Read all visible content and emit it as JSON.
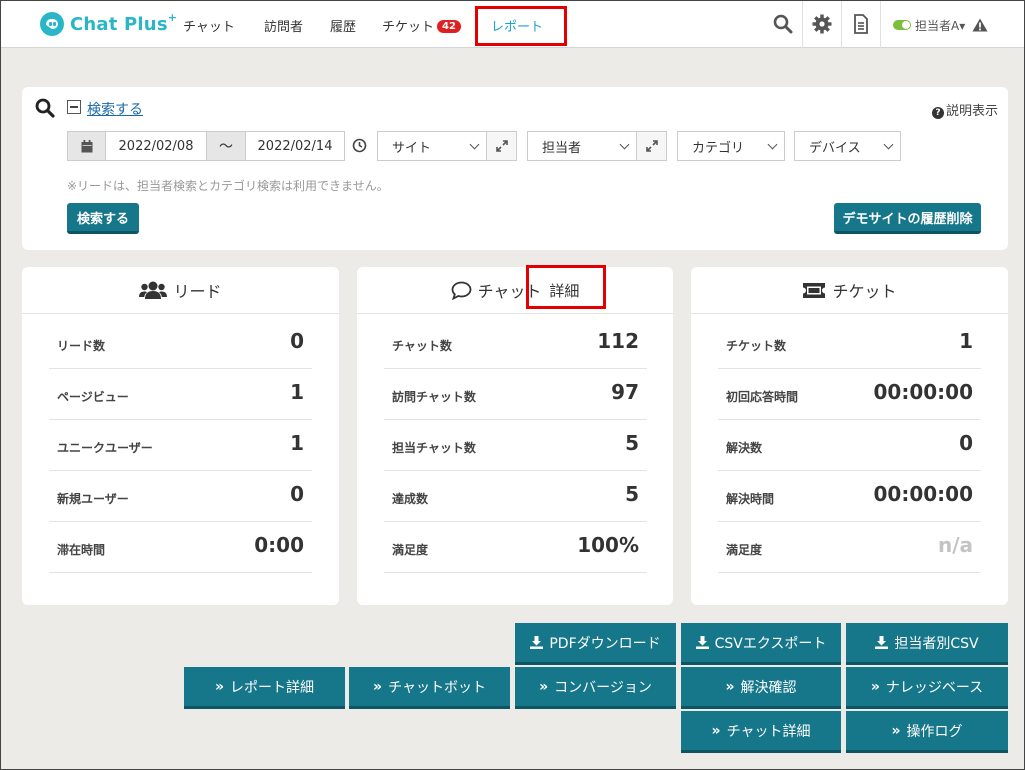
{
  "app": {
    "logo_text": "Chat Plus",
    "logo_plus": "+"
  },
  "nav": {
    "items": [
      {
        "label": "チャット"
      },
      {
        "label": "訪問者"
      },
      {
        "label": "履歴"
      },
      {
        "label": "チケット",
        "badge": "42"
      },
      {
        "label": "レポート"
      }
    ],
    "agent_label": "担当者A▾",
    "icons": [
      "search-icon",
      "gear-icon",
      "document-icon",
      "warning-icon"
    ]
  },
  "search": {
    "toggle_label": "検索する",
    "help_label": "説明表示",
    "date_from": "2022/02/08",
    "date_sep": "〜",
    "date_to": "2022/02/14",
    "site_select": "サイト",
    "agent_select": "担当者",
    "category_select": "カテゴリ",
    "device_select": "デバイス",
    "note": "※リードは、担当者検索とカテゴリ検索は利用できません。",
    "search_button": "検索する",
    "delete_button": "デモサイトの履歴削除"
  },
  "cards": {
    "lead": {
      "title": "リード",
      "rows": [
        {
          "label": "リード数",
          "value": "0"
        },
        {
          "label": "ページビュー",
          "value": "1"
        },
        {
          "label": "ユニークユーザー",
          "value": "1"
        },
        {
          "label": "新規ユーザー",
          "value": "0"
        },
        {
          "label": "滞在時間",
          "value": "0:00"
        }
      ]
    },
    "chat": {
      "title": "チャット",
      "detail_label": "詳細",
      "rows": [
        {
          "label": "チャット数",
          "value": "112"
        },
        {
          "label": "訪問チャット数",
          "value": "97"
        },
        {
          "label": "担当チャット数",
          "value": "5"
        },
        {
          "label": "達成数",
          "value": "5"
        },
        {
          "label": "満足度",
          "value": "100%"
        }
      ]
    },
    "ticket": {
      "title": "チケット",
      "rows": [
        {
          "label": "チケット数",
          "value": "1"
        },
        {
          "label": "初回応答時間",
          "value": "00:00:00"
        },
        {
          "label": "解決数",
          "value": "0"
        },
        {
          "label": "解決時間",
          "value": "00:00:00"
        },
        {
          "label": "満足度",
          "value": "n/a"
        }
      ]
    }
  },
  "actions": {
    "pdf_download": "PDFダウンロード",
    "csv_export": "CSVエクスポート",
    "agent_csv": "担当者別CSV",
    "report_detail": "レポート詳細",
    "chatbot": "チャットボット",
    "conversion": "コンバージョン",
    "resolution": "解決確認",
    "knowledge_base": "ナレッジベース",
    "chat_detail": "チャット詳細",
    "operation_log": "操作ログ"
  },
  "colors": {
    "accent": "#17778a",
    "brand": "#29b6c7",
    "highlight": "#e40000",
    "badge": "#e02020"
  }
}
